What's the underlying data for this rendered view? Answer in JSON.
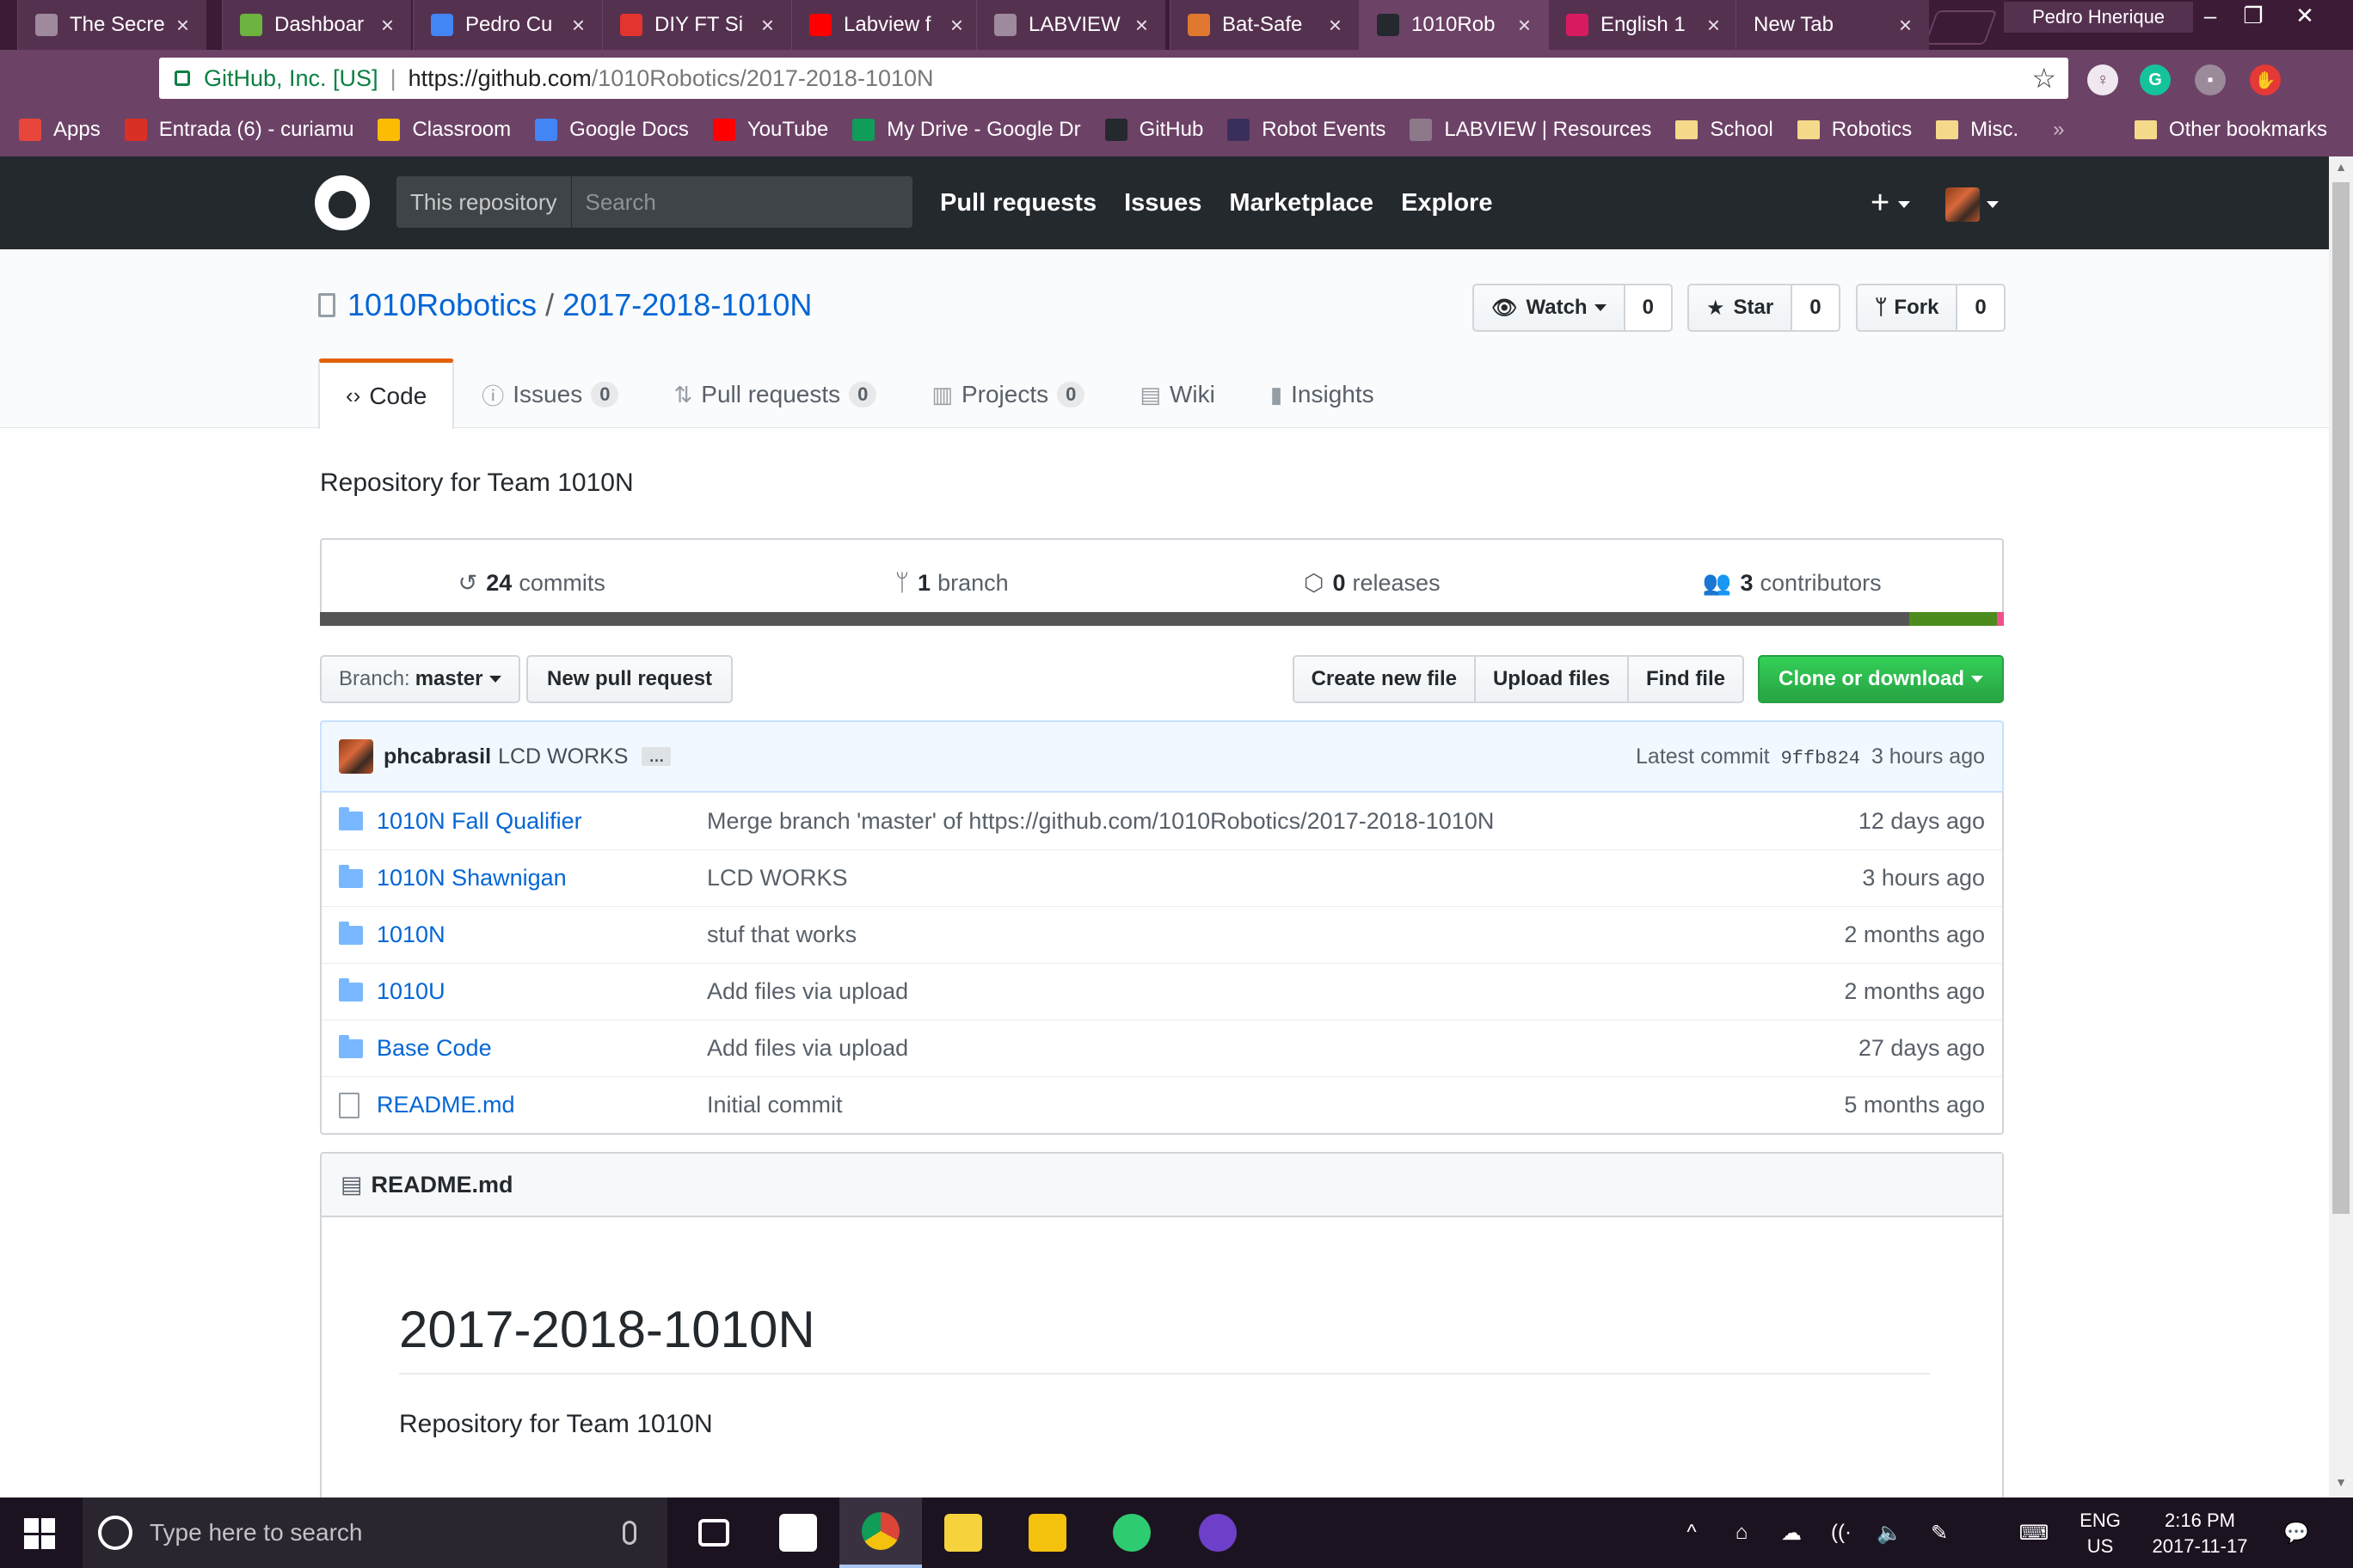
{
  "browser": {
    "tabs": [
      {
        "title": "The Secre",
        "icon": "page-icon",
        "color": "#9e8a9c"
      },
      {
        "title": "Dashboar",
        "icon": "leaf-icon",
        "color": "#6db33f"
      },
      {
        "title": "Pedro Cu",
        "icon": "docs-icon",
        "color": "#4285f4"
      },
      {
        "title": "DIY FT Si",
        "icon": "instructables-icon",
        "color": "#e3342f"
      },
      {
        "title": "Labview f",
        "icon": "youtube-icon",
        "color": "#ff0000"
      },
      {
        "title": "LABVIEW",
        "icon": "page-icon",
        "color": "#9e8a9c"
      },
      {
        "title": "Bat-Safe",
        "icon": "site-icon",
        "color": "#e0782f"
      },
      {
        "title": "1010Rob",
        "icon": "github-icon",
        "color": "#24292e",
        "active": true
      },
      {
        "title": "English 1",
        "icon": "classroom-icon",
        "color": "#d81b60"
      },
      {
        "title": "New Tab",
        "icon": "",
        "color": "#553150"
      }
    ],
    "profile_name": "Pedro Hnerique",
    "window_buttons": [
      "–",
      "❐",
      "✕"
    ],
    "omnibox": {
      "security_label": "GitHub, Inc. [US]",
      "url_host": "https://github.com",
      "url_path": "/1010Robotics/2017-2018-1010N"
    },
    "extensions": [
      {
        "name": "keep-icon",
        "glyph": "♀",
        "color": "#f0e8ef"
      },
      {
        "name": "grammarly-icon",
        "glyph": "G",
        "color": "#15c39a"
      },
      {
        "name": "extension-icon",
        "glyph": "▪",
        "color": "#9b8a99"
      },
      {
        "name": "adblock-icon",
        "glyph": "✋",
        "color": "#e53935"
      }
    ],
    "bookmarks": [
      {
        "label": "Apps",
        "icon": "apps-icon",
        "color": "#e8453c"
      },
      {
        "label": "Entrada (6) - curiamu",
        "icon": "gmail-icon",
        "color": "#d93025"
      },
      {
        "label": "Classroom",
        "icon": "classroom-icon",
        "color": "#fbbc04"
      },
      {
        "label": "Google Docs",
        "icon": "docs-icon",
        "color": "#4285f4"
      },
      {
        "label": "YouTube",
        "icon": "youtube-icon",
        "color": "#ff0000"
      },
      {
        "label": "My Drive - Google Dr",
        "icon": "drive-icon",
        "color": "#0f9d58"
      },
      {
        "label": "GitHub",
        "icon": "github-icon",
        "color": "#24292e"
      },
      {
        "label": "Robot Events",
        "icon": "robotevents-icon",
        "color": "#3a2f5c"
      },
      {
        "label": "LABVIEW | Resources",
        "icon": "page-icon",
        "color": "#8c7a8a"
      },
      {
        "label": "School",
        "icon": "folder-icon",
        "color": "#f5d98b",
        "folder": true
      },
      {
        "label": "Robotics",
        "icon": "folder-icon",
        "color": "#f5d98b",
        "folder": true
      },
      {
        "label": "Misc.",
        "icon": "folder-icon",
        "color": "#f5d98b",
        "folder": true
      }
    ],
    "overflow": "»",
    "other_bookmarks": "Other bookmarks"
  },
  "github": {
    "search_scope": "This repository",
    "search_placeholder": "Search",
    "nav": [
      "Pull requests",
      "Issues",
      "Marketplace",
      "Explore"
    ],
    "plus": "+"
  },
  "repo": {
    "owner": "1010Robotics",
    "name": "2017-2018-1010N",
    "watch": {
      "label": "Watch",
      "count": "0"
    },
    "star": {
      "label": "Star",
      "count": "0"
    },
    "fork": {
      "label": "Fork",
      "count": "0"
    },
    "tabs": [
      {
        "label": "Code",
        "icon": "‹›",
        "counter": ""
      },
      {
        "label": "Issues",
        "icon": "ⓘ",
        "counter": "0"
      },
      {
        "label": "Pull requests",
        "icon": "⇅",
        "counter": "0"
      },
      {
        "label": "Projects",
        "icon": "▥",
        "counter": "0"
      },
      {
        "label": "Wiki",
        "icon": "▤",
        "counter": ""
      },
      {
        "label": "Insights",
        "icon": "▮",
        "counter": ""
      }
    ],
    "description": "Repository for Team 1010N",
    "summary": [
      {
        "count": "24",
        "label": "commits",
        "icon": "history-icon",
        "glyph": "↺"
      },
      {
        "count": "1",
        "label": "branch",
        "icon": "branch-icon",
        "glyph": "ᛘ"
      },
      {
        "count": "0",
        "label": "releases",
        "icon": "tag-icon",
        "glyph": "⬡"
      },
      {
        "count": "3",
        "label": "contributors",
        "icon": "people-icon",
        "glyph": "👥"
      }
    ],
    "languages": [
      {
        "color": "#555555",
        "share": 0.944
      },
      {
        "color": "#4c8c1e",
        "share": 0.052
      },
      {
        "color": "#f0508c",
        "share": 0.004
      }
    ],
    "branch_prefix": "Branch:",
    "branch": "master",
    "new_pr": "New pull request",
    "actions": [
      "Create new file",
      "Upload files",
      "Find file"
    ],
    "clone": "Clone or download",
    "latest_commit": {
      "author": "phcabrasil",
      "message": "LCD WORKS",
      "ellipsis": "…",
      "prefix": "Latest commit",
      "sha": "9ffb824",
      "age": "3 hours ago"
    },
    "files": [
      {
        "name": "1010N Fall Qualifier",
        "type": "folder",
        "message": "Merge branch 'master' of https://github.com/1010Robotics/2017-2018-1010N",
        "age": "12 days ago"
      },
      {
        "name": "1010N Shawnigan",
        "type": "folder",
        "message": "LCD WORKS",
        "age": "3 hours ago"
      },
      {
        "name": "1010N",
        "type": "folder",
        "message": "stuf that works",
        "age": "2 months ago"
      },
      {
        "name": "1010U",
        "type": "folder",
        "message": "Add files via upload",
        "age": "2 months ago"
      },
      {
        "name": "Base Code",
        "type": "folder",
        "message": "Add files via upload",
        "age": "27 days ago"
      },
      {
        "name": "README.md",
        "type": "file",
        "message": "Initial commit",
        "age": "5 months ago"
      }
    ],
    "readme": {
      "filename": "README.md",
      "heading": "2017-2018-1010N",
      "body": "Repository for Team 1010N"
    }
  },
  "taskbar": {
    "search_placeholder": "Type here to search",
    "apps": [
      {
        "name": "task-view-icon",
        "color": "#1c1321"
      },
      {
        "name": "mail-icon",
        "color": "#ffffff"
      },
      {
        "name": "chrome-icon",
        "color": "#4caf50",
        "active": true
      },
      {
        "name": "sticky-notes-icon",
        "color": "#f6d33c"
      },
      {
        "name": "labview-icon",
        "color": "#f4c20d"
      },
      {
        "name": "atom-icon",
        "color": "#2ecc71"
      },
      {
        "name": "github-desktop-icon",
        "color": "#6e40c9"
      }
    ],
    "tray_glyphs": [
      "^",
      "⌂",
      "☁",
      "((·",
      "🔈",
      "✎",
      "⌨"
    ],
    "language": "ENG",
    "region": "US",
    "time": "2:16 PM",
    "date": "2017-11-17",
    "notifications_glyph": "💬"
  }
}
